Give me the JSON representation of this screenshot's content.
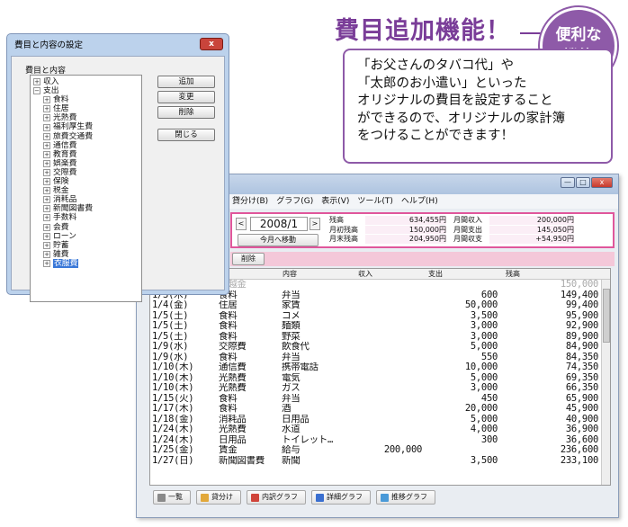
{
  "promo": {
    "headline": "費目追加機能！",
    "badge_line1": "便利な",
    "badge_line2": "機能",
    "body_lines": [
      "「お父さんのタバコ代」や",
      "「太郎のお小遣い」といった",
      "オリジナルの費目を設定すること",
      "ができるので、オリジナルの家計簿",
      "をつけることができます！"
    ]
  },
  "dialog": {
    "title": "費目と内容の設定",
    "close_glyph": "x",
    "list_label": "費目と内容",
    "tree": [
      {
        "label": "収入",
        "level": 0,
        "toggle": "+"
      },
      {
        "label": "支出",
        "level": 0,
        "toggle": "−"
      },
      {
        "label": "食料",
        "level": 1,
        "toggle": "+"
      },
      {
        "label": "住居",
        "level": 1,
        "toggle": "+"
      },
      {
        "label": "光熱費",
        "level": 1,
        "toggle": "+"
      },
      {
        "label": "福利厚生費",
        "level": 1,
        "toggle": "+"
      },
      {
        "label": "旅費交通費",
        "level": 1,
        "toggle": "+"
      },
      {
        "label": "通信費",
        "level": 1,
        "toggle": "+"
      },
      {
        "label": "教育費",
        "level": 1,
        "toggle": "+"
      },
      {
        "label": "娯楽費",
        "level": 1,
        "toggle": "+"
      },
      {
        "label": "交際費",
        "level": 1,
        "toggle": "+"
      },
      {
        "label": "保険",
        "level": 1,
        "toggle": "+"
      },
      {
        "label": "税金",
        "level": 1,
        "toggle": "+"
      },
      {
        "label": "消耗品",
        "level": 1,
        "toggle": "+"
      },
      {
        "label": "新聞図書費",
        "level": 1,
        "toggle": "+"
      },
      {
        "label": "手数料",
        "level": 1,
        "toggle": "+"
      },
      {
        "label": "会費",
        "level": 1,
        "toggle": "+"
      },
      {
        "label": "ローン",
        "level": 1,
        "toggle": "+"
      },
      {
        "label": "貯蓄",
        "level": 1,
        "toggle": "+"
      },
      {
        "label": "雑費",
        "level": 1,
        "toggle": "+"
      },
      {
        "label": "衣服費",
        "level": 1,
        "toggle": "+",
        "selected": true
      }
    ],
    "buttons": {
      "add": "追加",
      "change": "変更",
      "delete": "削除",
      "close": "閉じる"
    }
  },
  "main": {
    "window_buttons": {
      "minimize": "—",
      "maximize": "□",
      "close": "x"
    },
    "menu": [
      "貸分け(B)",
      "グラフ(G)",
      "表示(V)",
      "ツール(T)",
      "ヘルプ(H)"
    ],
    "nav": {
      "prev": "<",
      "next": ">",
      "month": "2008/1",
      "today": "今月へ移動"
    },
    "summary": [
      {
        "label": "残高",
        "value": "634,455円"
      },
      {
        "label": "月初残高",
        "value": "150,000円"
      },
      {
        "label": "月末残高",
        "value": "204,950円"
      },
      {
        "label": "月間収入",
        "value": "200,000円"
      },
      {
        "label": "月間支出",
        "value": "145,050円"
      },
      {
        "label": "月間収支",
        "value": "+54,950円"
      }
    ],
    "delete_label": "削除",
    "columns": [
      "目",
      "内容",
      "収入",
      "支出",
      "残高"
    ],
    "rows": [
      {
        "date": "",
        "category": "繰越金",
        "content": "",
        "income": "",
        "expense": "",
        "balance": "150,000",
        "muted": true
      },
      {
        "date": "1/3(木)",
        "category": "食料",
        "content": "弁当",
        "income": "",
        "expense": "600",
        "balance": "149,400"
      },
      {
        "date": "1/4(金)",
        "category": "住居",
        "content": "家賃",
        "income": "",
        "expense": "50,000",
        "balance": "99,400"
      },
      {
        "date": "1/5(土)",
        "category": "食料",
        "content": "コメ",
        "income": "",
        "expense": "3,500",
        "balance": "95,900"
      },
      {
        "date": "1/5(土)",
        "category": "食料",
        "content": "麺類",
        "income": "",
        "expense": "3,000",
        "balance": "92,900"
      },
      {
        "date": "1/5(土)",
        "category": "食料",
        "content": "野菜",
        "income": "",
        "expense": "3,000",
        "balance": "89,900"
      },
      {
        "date": "1/9(水)",
        "category": "交際費",
        "content": "飲食代",
        "income": "",
        "expense": "5,000",
        "balance": "84,900"
      },
      {
        "date": "1/9(水)",
        "category": "食料",
        "content": "弁当",
        "income": "",
        "expense": "550",
        "balance": "84,350"
      },
      {
        "date": "1/10(木)",
        "category": "通信費",
        "content": "携帯電話",
        "income": "",
        "expense": "10,000",
        "balance": "74,350"
      },
      {
        "date": "1/10(木)",
        "category": "光熱費",
        "content": "電気",
        "income": "",
        "expense": "5,000",
        "balance": "69,350"
      },
      {
        "date": "1/10(木)",
        "category": "光熱費",
        "content": "ガス",
        "income": "",
        "expense": "3,000",
        "balance": "66,350"
      },
      {
        "date": "1/15(火)",
        "category": "食料",
        "content": "弁当",
        "income": "",
        "expense": "450",
        "balance": "65,900"
      },
      {
        "date": "1/17(木)",
        "category": "食料",
        "content": "酒",
        "income": "",
        "expense": "20,000",
        "balance": "45,900"
      },
      {
        "date": "1/18(金)",
        "category": "消耗品",
        "content": "日用品",
        "income": "",
        "expense": "5,000",
        "balance": "40,900"
      },
      {
        "date": "1/24(木)",
        "category": "光熱費",
        "content": "水道",
        "income": "",
        "expense": "4,000",
        "balance": "36,900"
      },
      {
        "date": "1/24(木)",
        "category": "日用品",
        "content": "トイレット…",
        "income": "",
        "expense": "300",
        "balance": "36,600"
      },
      {
        "date": "1/25(金)",
        "category": "賃金",
        "content": "給与",
        "income": "200,000",
        "expense": "",
        "balance": "236,600"
      },
      {
        "date": "1/27(日)",
        "category": "新聞図書費",
        "content": "新聞",
        "income": "",
        "expense": "3,500",
        "balance": "233,100"
      }
    ],
    "tabs": [
      {
        "label": "一覧",
        "icon": "list-icon",
        "color": "#8a8a8a"
      },
      {
        "label": "貸分け",
        "icon": "folder-icon",
        "color": "#e2a83a"
      },
      {
        "label": "内訳グラフ",
        "icon": "pie-chart-icon",
        "color": "#d0443a"
      },
      {
        "label": "詳細グラフ",
        "icon": "bar-chart-icon",
        "color": "#3a6fd0"
      },
      {
        "label": "推移グラフ",
        "icon": "line-chart-icon",
        "color": "#4a9ad8"
      }
    ],
    "colors": {
      "accent_pink": "#e0569b",
      "promo_purple": "#7a3d98"
    }
  }
}
